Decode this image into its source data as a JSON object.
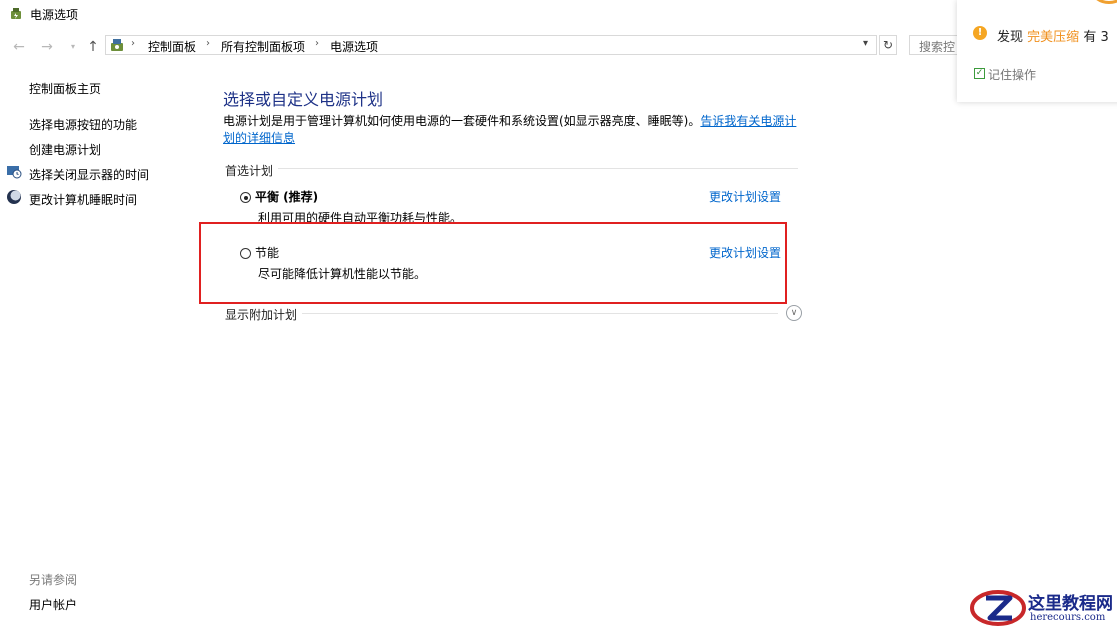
{
  "window": {
    "title": "电源选项"
  },
  "nav": {
    "back_icon": "arrow-left-icon",
    "forward_icon": "arrow-right-icon",
    "recent_icon": "chevron-down-icon",
    "up_icon": "arrow-up-icon"
  },
  "address": {
    "crumbs": [
      "控制面板",
      "所有控制面板项",
      "电源选项"
    ],
    "separator": "›"
  },
  "search": {
    "placeholder": "搜索控"
  },
  "sidebar": {
    "home": "控制面板主页",
    "items": [
      {
        "label": "选择电源按钮的功能",
        "icon": null
      },
      {
        "label": "创建电源计划",
        "icon": null
      },
      {
        "label": "选择关闭显示器的时间",
        "icon": "monitor-clock-icon"
      },
      {
        "label": "更改计算机睡眠时间",
        "icon": "moon-icon"
      }
    ],
    "see_also_label": "另请参阅",
    "see_also_items": [
      "用户帐户"
    ]
  },
  "main": {
    "heading": "选择或自定义电源计划",
    "description": "电源计划是用于管理计算机如何使用电源的一套硬件和系统设置(如显示器亮度、睡眠等)。",
    "learn_more": "告诉我有关电源计划的详细信息",
    "preferred_label": "首选计划",
    "plans": [
      {
        "name": "平衡 (推荐)",
        "desc": "利用可用的硬件自动平衡功耗与性能。",
        "selected": true,
        "change": "更改计划设置"
      },
      {
        "name": "节能",
        "desc": "尽可能降低计算机性能以节能。",
        "selected": false,
        "change": "更改计划设置"
      }
    ],
    "additional_label": "显示附加计划"
  },
  "popup": {
    "prefix": "发现",
    "highlight": "完美压缩",
    "suffix": "有 3",
    "remember": "记住操作",
    "accent_color": "#f0901e"
  },
  "watermark": {
    "title": "这里教程网",
    "url": "herecours.com"
  }
}
